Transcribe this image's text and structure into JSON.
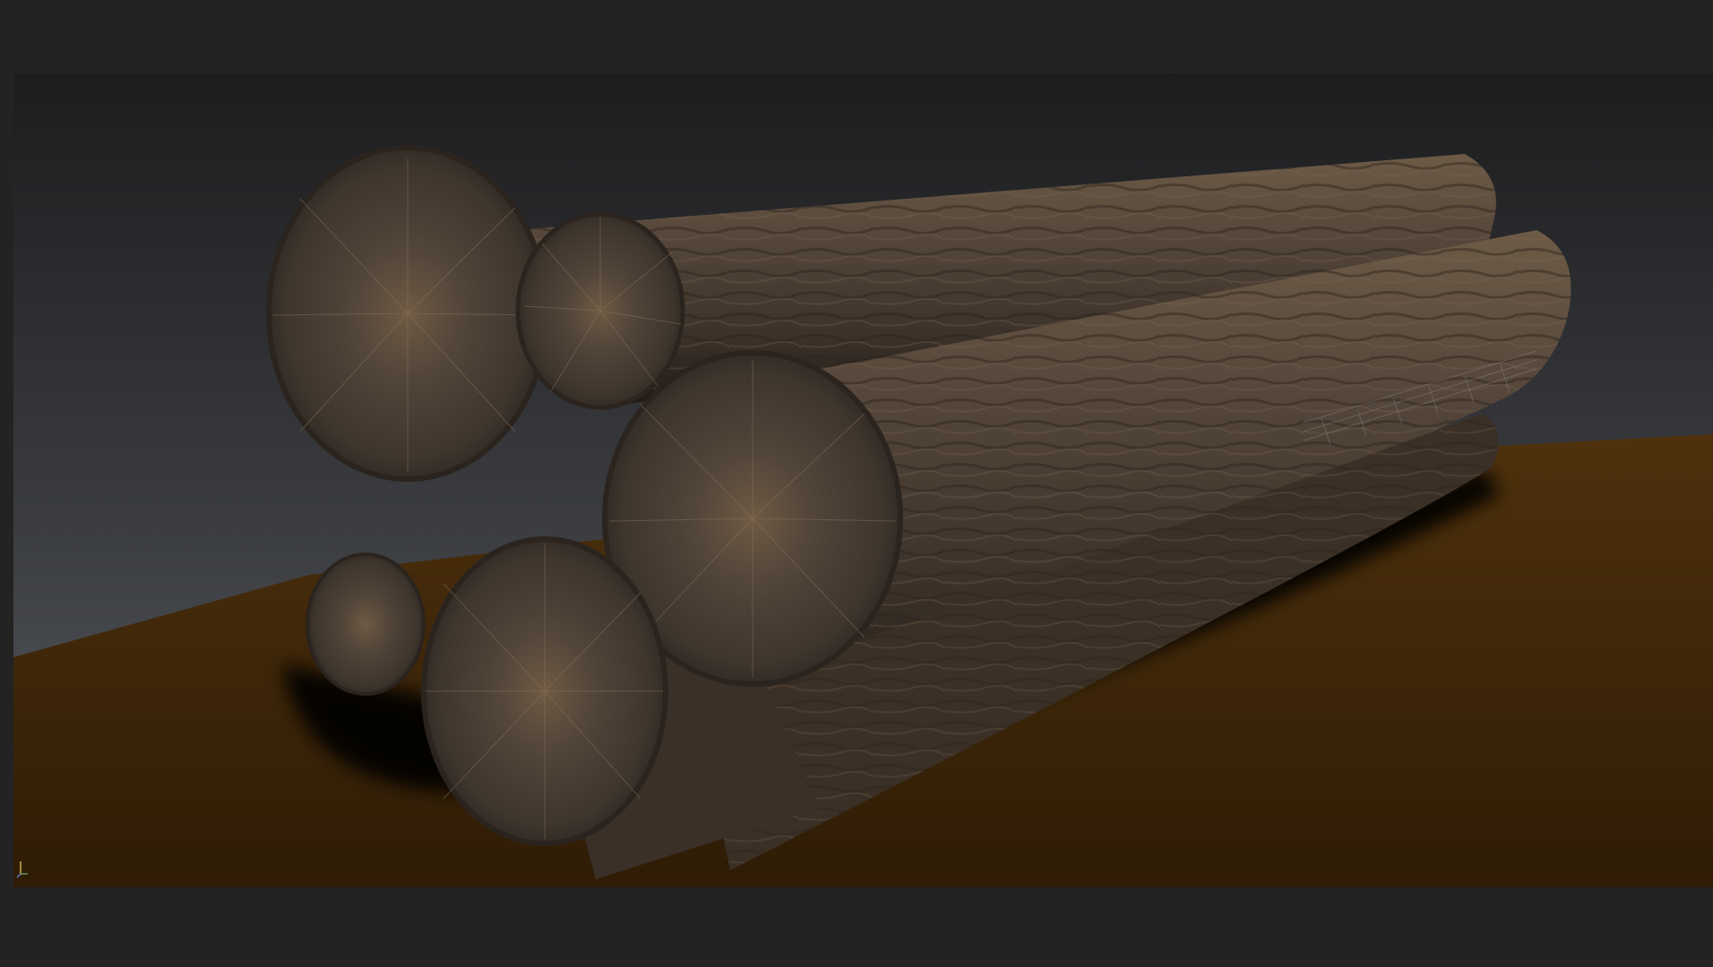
{
  "app": {
    "viewport": {
      "name": "3d-viewport",
      "scene": "stack-of-logs"
    },
    "colors": {
      "background_top": "#1e1e20",
      "background_bottom": "#4f5258",
      "ground": "#3a2307",
      "ground_far": "#4a2e0b",
      "bark_dark": "#2c241d",
      "bark_mid": "#4f4234",
      "bark_light": "#6b5a47",
      "end_grain": "#4a3f34",
      "end_grain_center": "#6a5640",
      "frame": "#232324"
    },
    "gizmo": {
      "icon": "axis-gizmo-icon"
    }
  }
}
